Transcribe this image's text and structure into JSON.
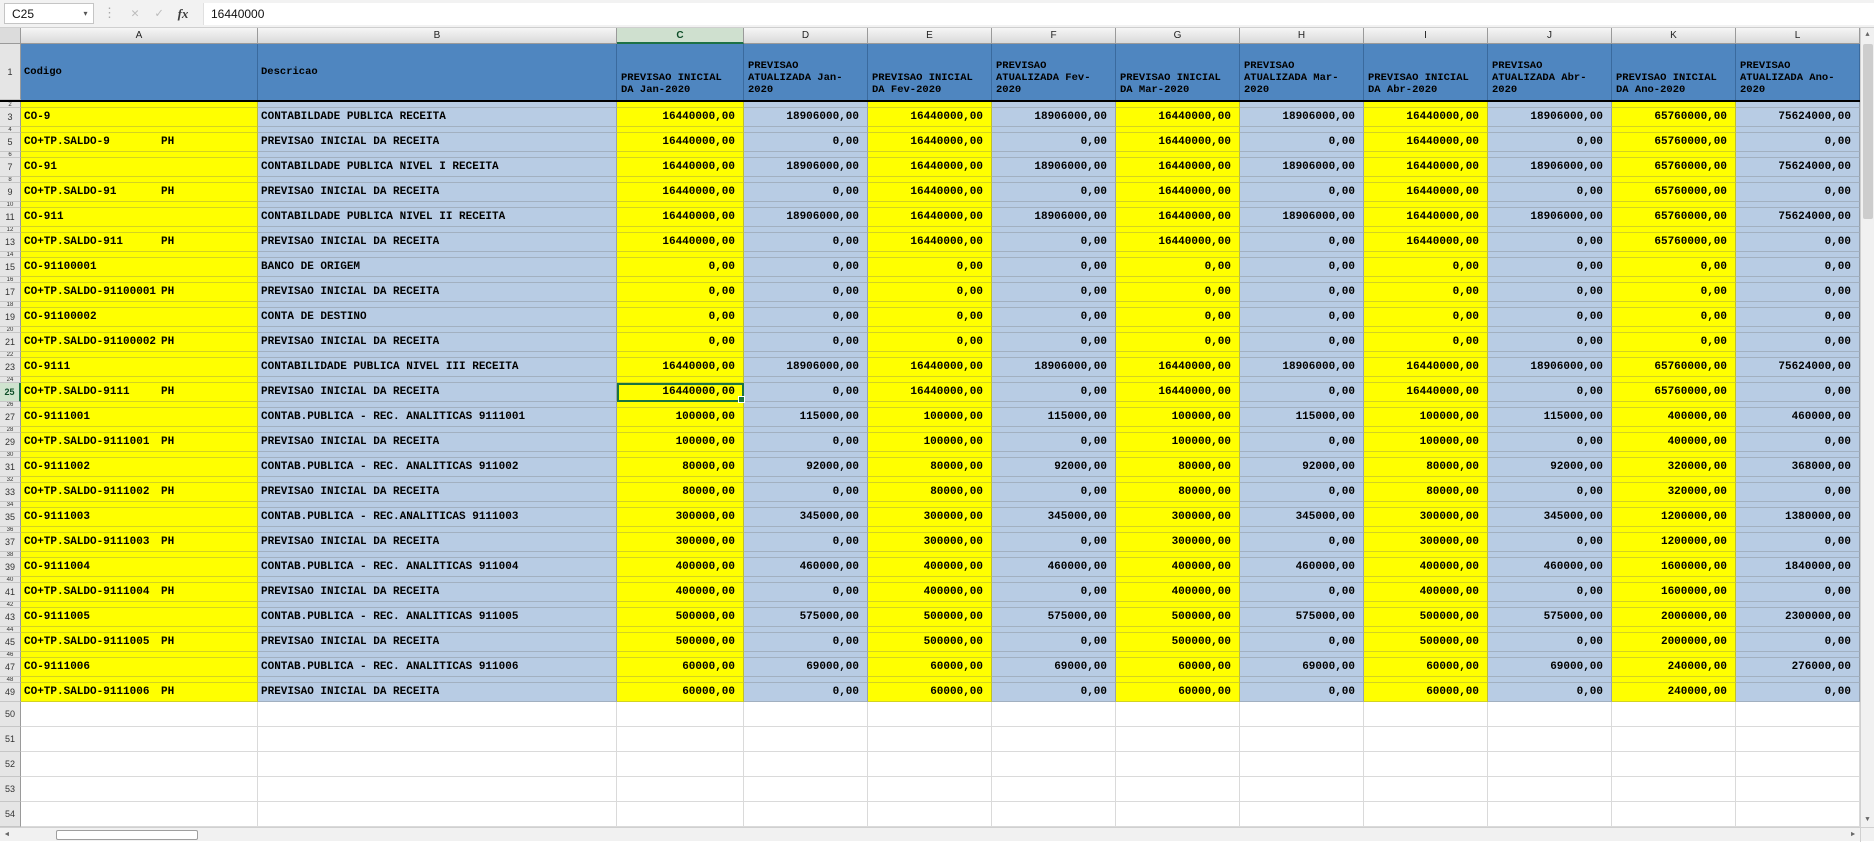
{
  "formula_bar": {
    "name_box": "C25",
    "value": "16440000",
    "icons": {
      "dropdown": "▾",
      "dots": "⋮",
      "cancel": "✕",
      "enter": "✓",
      "fx": "fx"
    }
  },
  "scrollbar_icons": {
    "up": "▲",
    "down": "▼",
    "left": "◄",
    "right": "►"
  },
  "colors": {
    "header_fill": "#4f86c0",
    "odd_column_fill": "#ffff00",
    "even_column_fill": "#b8cce4",
    "selection_border": "#1a7340"
  },
  "grid": {
    "column_letters": [
      "A",
      "B",
      "C",
      "D",
      "E",
      "F",
      "G",
      "H",
      "I",
      "J",
      "K",
      "L"
    ],
    "selected": {
      "cell": "C25",
      "column": "C",
      "row": 25
    },
    "header": {
      "codigo": "Codigo",
      "descricao": "Descricao",
      "value_columns": [
        "PREVISAO INICIAL DA Jan-2020",
        "PREVISAO ATUALIZADA Jan-2020",
        "PREVISAO INICIAL DA Fev-2020",
        "PREVISAO ATUALIZADA Fev-2020",
        "PREVISAO INICIAL DA Mar-2020",
        "PREVISAO ATUALIZADA Mar-2020",
        "PREVISAO INICIAL DA Abr-2020",
        "PREVISAO ATUALIZADA Abr-2020",
        "PREVISAO INICIAL DA Ano-2020",
        "PREVISAO ATUALIZADA Ano-2020"
      ]
    },
    "rows": [
      {
        "n": 3,
        "code": "CO-9",
        "tag": "",
        "desc": "CONTABILDADE PUBLICA RECEITA",
        "values": [
          "16440000,00",
          "18906000,00",
          "16440000,00",
          "18906000,00",
          "16440000,00",
          "18906000,00",
          "16440000,00",
          "18906000,00",
          "65760000,00",
          "75624000,00"
        ]
      },
      {
        "n": 5,
        "code": "CO+TP.SALDO-9",
        "tag": "PH",
        "desc": "PREVISAO INICIAL DA RECEITA",
        "values": [
          "16440000,00",
          "0,00",
          "16440000,00",
          "0,00",
          "16440000,00",
          "0,00",
          "16440000,00",
          "0,00",
          "65760000,00",
          "0,00"
        ]
      },
      {
        "n": 7,
        "code": "CO-91",
        "tag": "",
        "desc": "CONTABILDADE PUBLICA NIVEL I RECEITA",
        "values": [
          "16440000,00",
          "18906000,00",
          "16440000,00",
          "18906000,00",
          "16440000,00",
          "18906000,00",
          "16440000,00",
          "18906000,00",
          "65760000,00",
          "75624000,00"
        ]
      },
      {
        "n": 9,
        "code": "CO+TP.SALDO-91",
        "tag": "PH",
        "desc": "PREVISAO INICIAL DA RECEITA",
        "values": [
          "16440000,00",
          "0,00",
          "16440000,00",
          "0,00",
          "16440000,00",
          "0,00",
          "16440000,00",
          "0,00",
          "65760000,00",
          "0,00"
        ]
      },
      {
        "n": 11,
        "code": "CO-911",
        "tag": "",
        "desc": "CONTABILDADE PUBLICA NIVEL II RECEITA",
        "values": [
          "16440000,00",
          "18906000,00",
          "16440000,00",
          "18906000,00",
          "16440000,00",
          "18906000,00",
          "16440000,00",
          "18906000,00",
          "65760000,00",
          "75624000,00"
        ]
      },
      {
        "n": 13,
        "code": "CO+TP.SALDO-911",
        "tag": "PH",
        "desc": "PREVISAO INICIAL DA RECEITA",
        "values": [
          "16440000,00",
          "0,00",
          "16440000,00",
          "0,00",
          "16440000,00",
          "0,00",
          "16440000,00",
          "0,00",
          "65760000,00",
          "0,00"
        ]
      },
      {
        "n": 15,
        "code": "CO-91100001",
        "tag": "",
        "desc": "BANCO DE ORIGEM",
        "values": [
          "0,00",
          "0,00",
          "0,00",
          "0,00",
          "0,00",
          "0,00",
          "0,00",
          "0,00",
          "0,00",
          "0,00"
        ]
      },
      {
        "n": 17,
        "code": "CO+TP.SALDO-91100001",
        "tag": "PH",
        "desc": "PREVISAO INICIAL DA RECEITA",
        "values": [
          "0,00",
          "0,00",
          "0,00",
          "0,00",
          "0,00",
          "0,00",
          "0,00",
          "0,00",
          "0,00",
          "0,00"
        ]
      },
      {
        "n": 19,
        "code": "CO-91100002",
        "tag": "",
        "desc": "CONTA DE DESTINO",
        "values": [
          "0,00",
          "0,00",
          "0,00",
          "0,00",
          "0,00",
          "0,00",
          "0,00",
          "0,00",
          "0,00",
          "0,00"
        ]
      },
      {
        "n": 21,
        "code": "CO+TP.SALDO-91100002",
        "tag": "PH",
        "desc": "PREVISAO INICIAL DA RECEITA",
        "values": [
          "0,00",
          "0,00",
          "0,00",
          "0,00",
          "0,00",
          "0,00",
          "0,00",
          "0,00",
          "0,00",
          "0,00"
        ]
      },
      {
        "n": 23,
        "code": "CO-9111",
        "tag": "",
        "desc": "CONTABILIDADE PUBLICA NIVEL III RECEITA",
        "values": [
          "16440000,00",
          "18906000,00",
          "16440000,00",
          "18906000,00",
          "16440000,00",
          "18906000,00",
          "16440000,00",
          "18906000,00",
          "65760000,00",
          "75624000,00"
        ]
      },
      {
        "n": 25,
        "code": "CO+TP.SALDO-9111",
        "tag": "PH",
        "desc": "PREVISAO INICIAL DA RECEITA",
        "values": [
          "16440000,00",
          "0,00",
          "16440000,00",
          "0,00",
          "16440000,00",
          "0,00",
          "16440000,00",
          "0,00",
          "65760000,00",
          "0,00"
        ]
      },
      {
        "n": 27,
        "code": "CO-9111001",
        "tag": "",
        "desc": "CONTAB.PUBLICA - REC. ANALITICAS 9111001",
        "values": [
          "100000,00",
          "115000,00",
          "100000,00",
          "115000,00",
          "100000,00",
          "115000,00",
          "100000,00",
          "115000,00",
          "400000,00",
          "460000,00"
        ]
      },
      {
        "n": 29,
        "code": "CO+TP.SALDO-9111001",
        "tag": "PH",
        "desc": "PREVISAO INICIAL DA RECEITA",
        "values": [
          "100000,00",
          "0,00",
          "100000,00",
          "0,00",
          "100000,00",
          "0,00",
          "100000,00",
          "0,00",
          "400000,00",
          "0,00"
        ]
      },
      {
        "n": 31,
        "code": "CO-9111002",
        "tag": "",
        "desc": "CONTAB.PUBLICA - REC. ANALITICAS 911002",
        "values": [
          "80000,00",
          "92000,00",
          "80000,00",
          "92000,00",
          "80000,00",
          "92000,00",
          "80000,00",
          "92000,00",
          "320000,00",
          "368000,00"
        ]
      },
      {
        "n": 33,
        "code": "CO+TP.SALDO-9111002",
        "tag": "PH",
        "desc": "PREVISAO INICIAL DA RECEITA",
        "values": [
          "80000,00",
          "0,00",
          "80000,00",
          "0,00",
          "80000,00",
          "0,00",
          "80000,00",
          "0,00",
          "320000,00",
          "0,00"
        ]
      },
      {
        "n": 35,
        "code": "CO-9111003",
        "tag": "",
        "desc": "CONTAB.PUBLICA - REC.ANALITICAS 9111003",
        "values": [
          "300000,00",
          "345000,00",
          "300000,00",
          "345000,00",
          "300000,00",
          "345000,00",
          "300000,00",
          "345000,00",
          "1200000,00",
          "1380000,00"
        ]
      },
      {
        "n": 37,
        "code": "CO+TP.SALDO-9111003",
        "tag": "PH",
        "desc": "PREVISAO INICIAL DA RECEITA",
        "values": [
          "300000,00",
          "0,00",
          "300000,00",
          "0,00",
          "300000,00",
          "0,00",
          "300000,00",
          "0,00",
          "1200000,00",
          "0,00"
        ]
      },
      {
        "n": 39,
        "code": "CO-9111004",
        "tag": "",
        "desc": "CONTAB.PUBLICA - REC. ANALITICAS 911004",
        "values": [
          "400000,00",
          "460000,00",
          "400000,00",
          "460000,00",
          "400000,00",
          "460000,00",
          "400000,00",
          "460000,00",
          "1600000,00",
          "1840000,00"
        ]
      },
      {
        "n": 41,
        "code": "CO+TP.SALDO-9111004",
        "tag": "PH",
        "desc": "PREVISAO INICIAL DA RECEITA",
        "values": [
          "400000,00",
          "0,00",
          "400000,00",
          "0,00",
          "400000,00",
          "0,00",
          "400000,00",
          "0,00",
          "1600000,00",
          "0,00"
        ]
      },
      {
        "n": 43,
        "code": "CO-9111005",
        "tag": "",
        "desc": "CONTAB.PUBLICA - REC. ANALITICAS 911005",
        "values": [
          "500000,00",
          "575000,00",
          "500000,00",
          "575000,00",
          "500000,00",
          "575000,00",
          "500000,00",
          "575000,00",
          "2000000,00",
          "2300000,00"
        ]
      },
      {
        "n": 45,
        "code": "CO+TP.SALDO-9111005",
        "tag": "PH",
        "desc": "PREVISAO INICIAL DA RECEITA",
        "values": [
          "500000,00",
          "0,00",
          "500000,00",
          "0,00",
          "500000,00",
          "0,00",
          "500000,00",
          "0,00",
          "2000000,00",
          "0,00"
        ]
      },
      {
        "n": 47,
        "code": "CO-9111006",
        "tag": "",
        "desc": "CONTAB.PUBLICA - REC. ANALITICAS 911006",
        "values": [
          "60000,00",
          "69000,00",
          "60000,00",
          "69000,00",
          "60000,00",
          "69000,00",
          "60000,00",
          "69000,00",
          "240000,00",
          "276000,00"
        ]
      },
      {
        "n": 49,
        "code": "CO+TP.SALDO-9111006",
        "tag": "PH",
        "desc": "PREVISAO INICIAL DA RECEITA",
        "values": [
          "60000,00",
          "0,00",
          "60000,00",
          "0,00",
          "60000,00",
          "0,00",
          "60000,00",
          "0,00",
          "240000,00",
          "0,00"
        ]
      }
    ],
    "empty_rows": [
      50,
      51,
      52,
      53,
      54
    ]
  }
}
